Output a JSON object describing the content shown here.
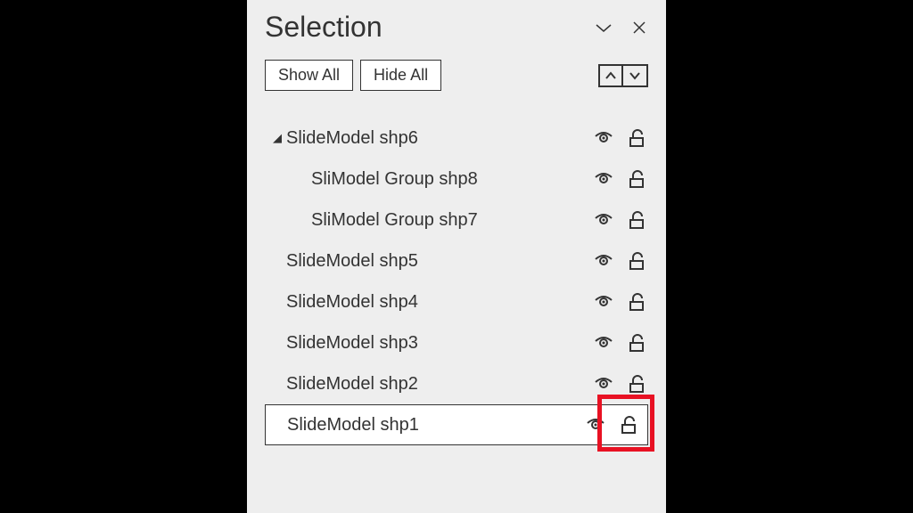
{
  "panel": {
    "title": "Selection"
  },
  "toolbar": {
    "show_all": "Show All",
    "hide_all": "Hide All"
  },
  "tree": {
    "items": [
      {
        "label": "SlideModel shp6",
        "indent": 0,
        "expanded": true,
        "visible": true,
        "locked": false,
        "selected": false
      },
      {
        "label": "SliModel Group shp8",
        "indent": 1,
        "expanded": null,
        "visible": true,
        "locked": false,
        "selected": false
      },
      {
        "label": "SliModel Group shp7",
        "indent": 1,
        "expanded": null,
        "visible": true,
        "locked": false,
        "selected": false
      },
      {
        "label": "SlideModel shp5",
        "indent": 0,
        "expanded": null,
        "visible": true,
        "locked": false,
        "selected": false
      },
      {
        "label": "SlideModel shp4",
        "indent": 0,
        "expanded": null,
        "visible": true,
        "locked": false,
        "selected": false
      },
      {
        "label": "SlideModel shp3",
        "indent": 0,
        "expanded": null,
        "visible": true,
        "locked": false,
        "selected": false
      },
      {
        "label": "SlideModel shp2",
        "indent": 0,
        "expanded": null,
        "visible": true,
        "locked": false,
        "selected": false
      },
      {
        "label": "SlideModel shp1",
        "indent": 0,
        "expanded": null,
        "visible": true,
        "locked": false,
        "selected": true
      }
    ]
  },
  "colors": {
    "highlight": "#e81123",
    "panel_bg": "#eeeeee",
    "stroke": "#333333"
  }
}
